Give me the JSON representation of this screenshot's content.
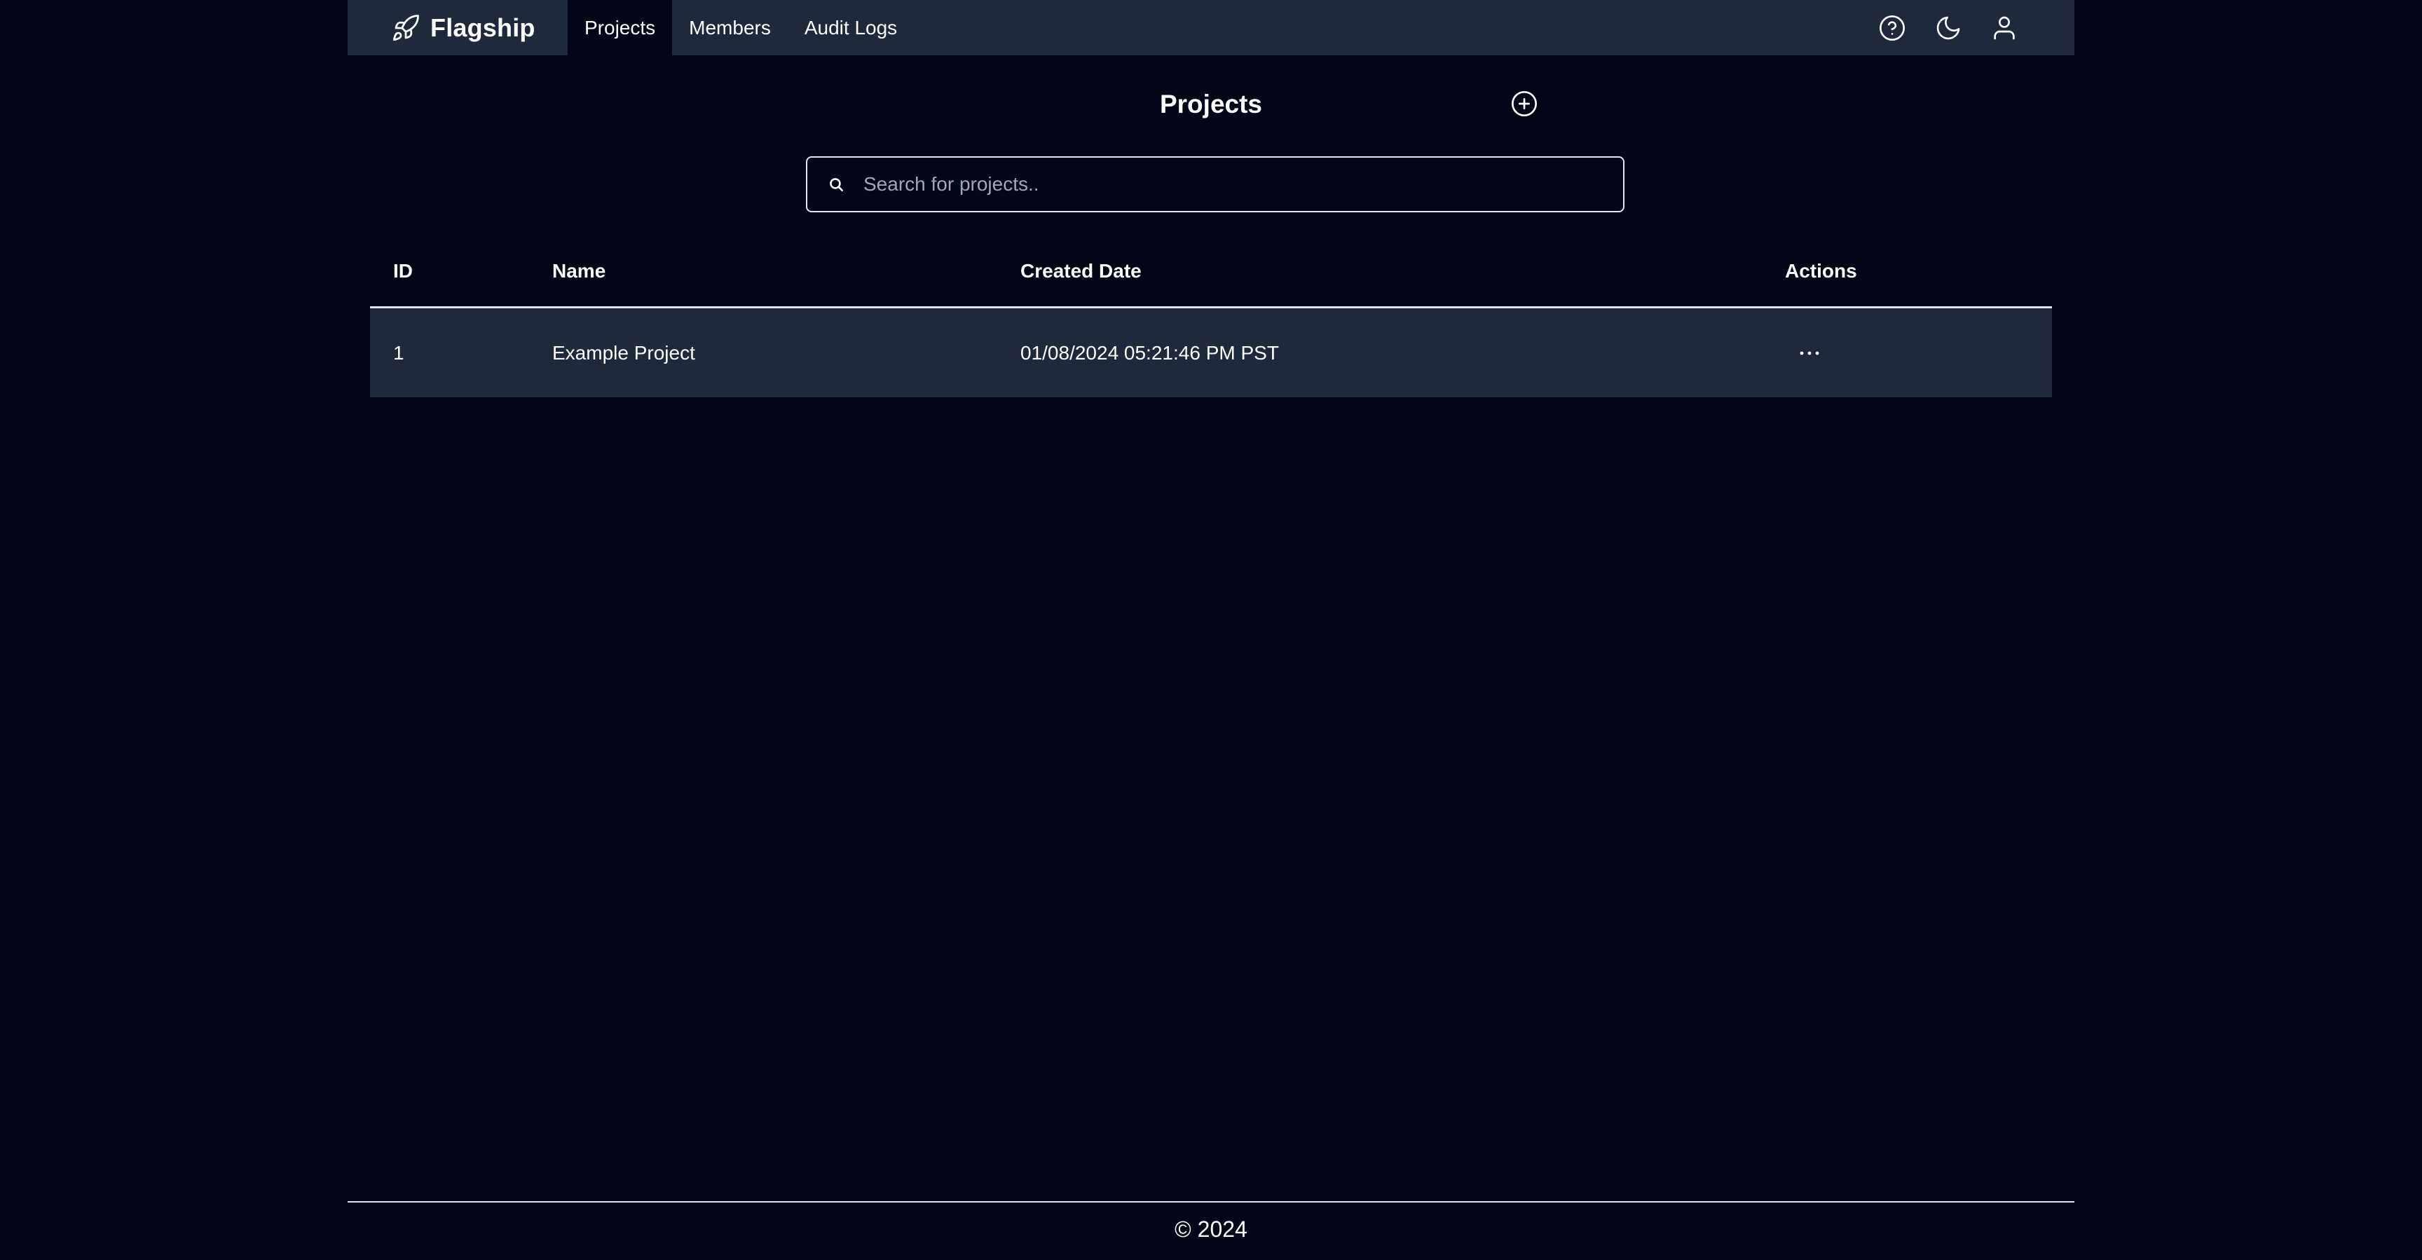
{
  "app": {
    "brand_name": "Flagship",
    "brand_icon": "rocket-icon"
  },
  "nav": {
    "links": [
      {
        "label": "Projects",
        "active": true
      },
      {
        "label": "Members",
        "active": false
      },
      {
        "label": "Audit Logs",
        "active": false
      }
    ],
    "icons": [
      "help-circle-icon",
      "moon-icon",
      "user-icon"
    ]
  },
  "page": {
    "title": "Projects",
    "add_icon": "plus-circle-icon"
  },
  "search": {
    "placeholder": "Search for projects..",
    "value": ""
  },
  "table": {
    "columns": [
      "ID",
      "Name",
      "Created Date",
      "Actions"
    ],
    "rows": [
      {
        "id": "1",
        "name": "Example Project",
        "created": "01/08/2024 05:21:46 PM PST",
        "actions_icon": "more-horizontal-icon"
      }
    ]
  },
  "footer": {
    "text": "© 2024"
  },
  "colors": {
    "background": "#030616",
    "navbar": "#1e293b",
    "row": "#1e293b",
    "border": "#e2e8f0",
    "text": "#ffffff"
  }
}
